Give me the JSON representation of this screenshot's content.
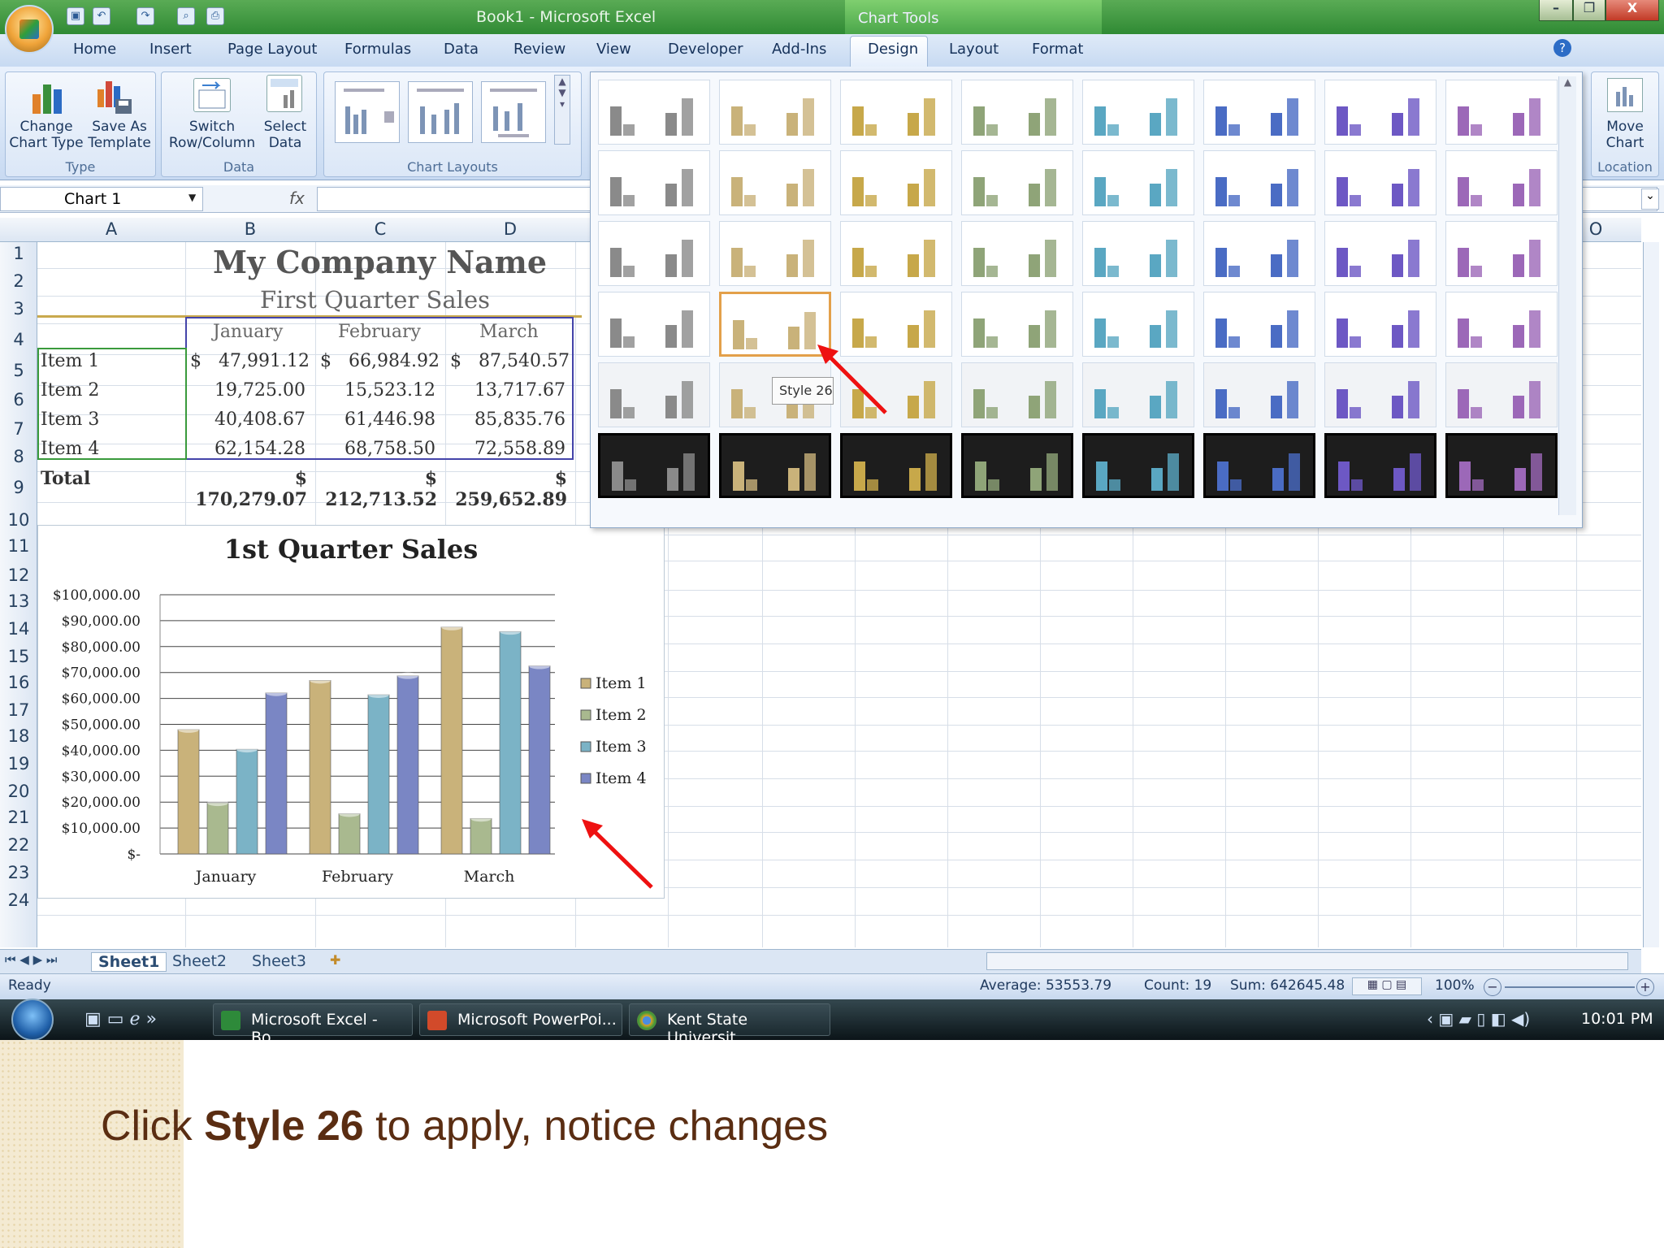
{
  "window": {
    "title": "Book1 - Microsoft Excel",
    "context_tab": "Chart Tools",
    "controls": {
      "minimize": "–",
      "restore": "❐",
      "close": "X"
    }
  },
  "ribbon": {
    "tabs": [
      "Home",
      "Insert",
      "Page Layout",
      "Formulas",
      "Data",
      "Review",
      "View",
      "Developer",
      "Add-Ins",
      "Design",
      "Layout",
      "Format"
    ],
    "active_tab": "Design",
    "groups": {
      "type": {
        "label": "Type",
        "change_chart_type": "Change\nChart Type",
        "save_as_template": "Save As\nTemplate"
      },
      "data": {
        "label": "Data",
        "switch": "Switch\nRow/Column",
        "select_data": "Select\nData"
      },
      "layouts": {
        "label": "Chart Layouts"
      },
      "location": {
        "label": "Location",
        "move_chart": "Move\nChart"
      }
    }
  },
  "formula_bar": {
    "name_box": "Chart 1",
    "fx": "fx",
    "formula": ""
  },
  "columns": [
    "A",
    "B",
    "C",
    "D",
    "O"
  ],
  "rows": [
    "1",
    "2",
    "3",
    "4",
    "5",
    "6",
    "7",
    "8",
    "9",
    "10",
    "11",
    "12",
    "13",
    "14",
    "15",
    "16",
    "17",
    "18",
    "19",
    "20",
    "21",
    "22",
    "23",
    "24"
  ],
  "sheet": {
    "company": "My Company Name",
    "subtitle": "First Quarter Sales",
    "headers": [
      "January",
      "February",
      "March"
    ],
    "items": [
      {
        "name": "Item 1",
        "jan": "$   47,991.12",
        "feb": "$   66,984.92",
        "mar": "$   87,540.57"
      },
      {
        "name": "Item 2",
        "jan": "19,725.00",
        "feb": "15,523.12",
        "mar": "13,717.67"
      },
      {
        "name": "Item 3",
        "jan": "40,408.67",
        "feb": "61,446.98",
        "mar": "85,835.76"
      },
      {
        "name": "Item 4",
        "jan": "62,154.28",
        "feb": "68,758.50",
        "mar": "72,558.89"
      }
    ],
    "total": {
      "name": "Total",
      "jan": "$ 170,279.07",
      "feb": "$ 212,713.52",
      "mar": "$ 259,652.89"
    }
  },
  "gallery": {
    "tooltip": "Style 26"
  },
  "chart_data": {
    "type": "bar",
    "title": "1st Quarter Sales",
    "categories": [
      "January",
      "February",
      "March"
    ],
    "series": [
      {
        "name": "Item 1",
        "values": [
          47991.12,
          66984.92,
          87540.57
        ],
        "color": "#c9b27a"
      },
      {
        "name": "Item 2",
        "values": [
          19725.0,
          15523.12,
          13717.67
        ],
        "color": "#a9b98f"
      },
      {
        "name": "Item 3",
        "values": [
          40408.67,
          61446.98,
          85835.76
        ],
        "color": "#7bb3c6"
      },
      {
        "name": "Item 4",
        "values": [
          62154.28,
          68758.5,
          72558.89
        ],
        "color": "#7a86c4"
      }
    ],
    "ylim": [
      0,
      100000
    ],
    "yticks": [
      "$100,000.00",
      "$90,000.00",
      "$80,000.00",
      "$70,000.00",
      "$60,000.00",
      "$50,000.00",
      "$40,000.00",
      "$30,000.00",
      "$20,000.00",
      "$10,000.00",
      "$-"
    ],
    "legend": "right",
    "grid": true
  },
  "sheet_tabs": [
    "Sheet1",
    "Sheet2",
    "Sheet3"
  ],
  "status": {
    "ready": "Ready",
    "average": "Average: 53553.79",
    "count": "Count: 19",
    "sum": "Sum: 642645.48",
    "zoom": "100%"
  },
  "taskbar": {
    "tasks": [
      "Microsoft Excel - Bo...",
      "Microsoft PowerPoi...",
      "Kent State Universit..."
    ],
    "time": "10:01 PM"
  },
  "caption": {
    "pre": "Click ",
    "bold": "Style 26",
    "post": " to apply, notice changes"
  },
  "colors": {
    "title_green": "#3a9a3c",
    "caption": "#5a2d12",
    "ribbon": "#dce8f7"
  }
}
